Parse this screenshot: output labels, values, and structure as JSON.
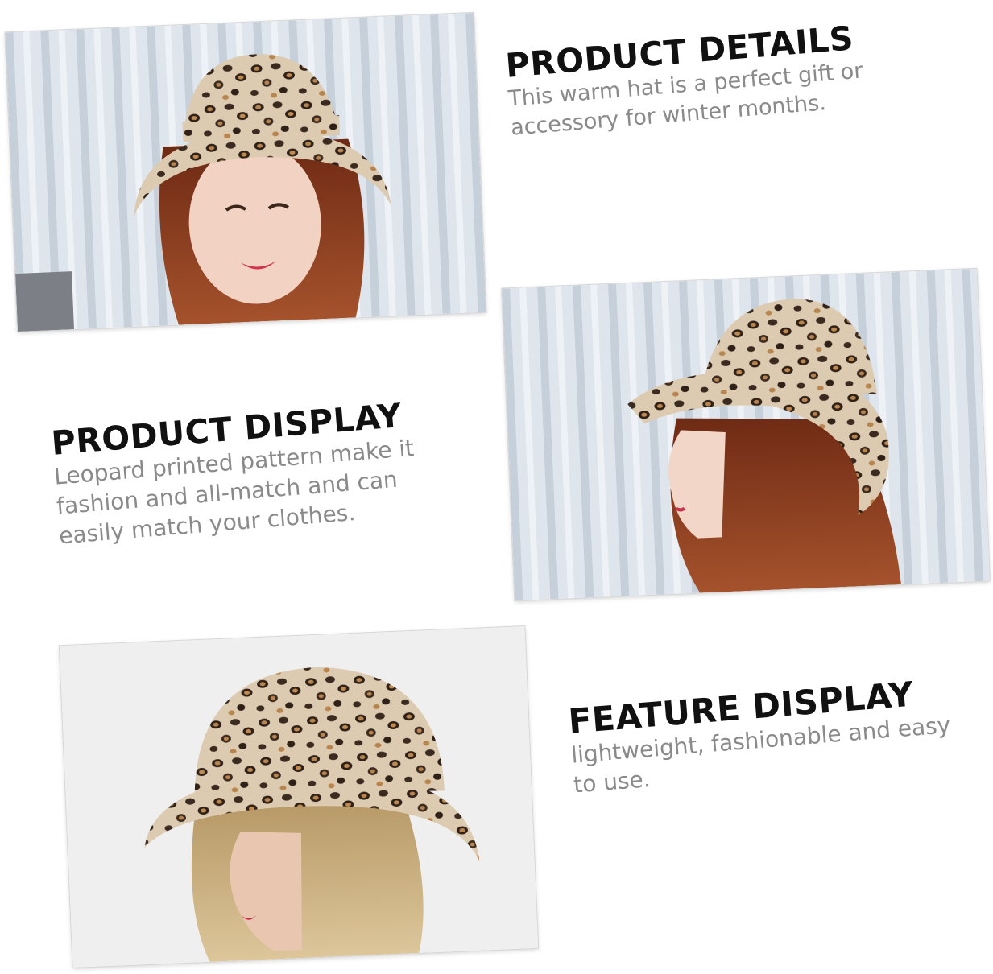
{
  "sections": [
    {
      "title": "PRODUCT DETAILS",
      "body": [
        "This warm hat is a perfect gift or",
        "accessory for winter months."
      ]
    },
    {
      "title": "PRODUCT DISPLAY",
      "body": [
        "Leopard printed pattern make it",
        "fashion and all-match and can",
        "easily match your clothes."
      ]
    },
    {
      "title": "FEATURE DISPLAY",
      "body": [
        "lightweight, fashionable and easy",
        "to use."
      ]
    }
  ],
  "photos": [
    {
      "icon": "model-front-photo"
    },
    {
      "icon": "model-side-photo"
    },
    {
      "icon": "mannequin-photo"
    }
  ],
  "colors": {
    "leopard_base": "#d9c7ad",
    "leopard_spot": "#3a2a20",
    "leopard_tan": "#b9854e",
    "hair": "#8a3b1f",
    "curtain": "#c9d2dc"
  }
}
